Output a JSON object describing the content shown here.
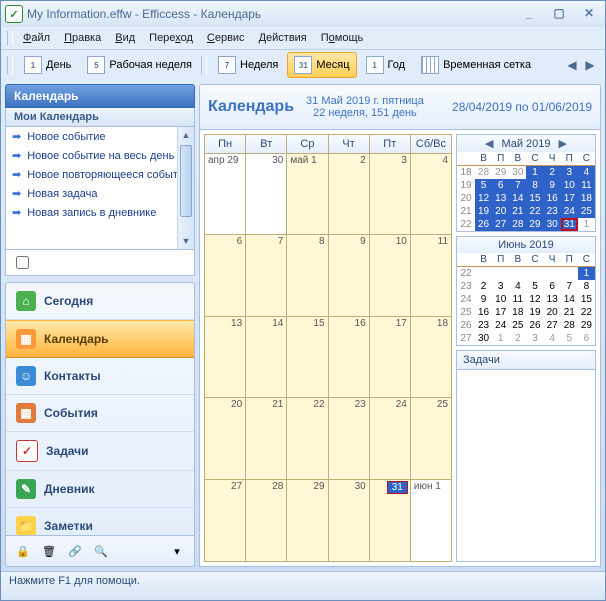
{
  "window": {
    "title": "My Information.effw - Efficcess - Календарь"
  },
  "menu": {
    "file": "Файл",
    "edit": "Правка",
    "view": "Вид",
    "goto": "Переход",
    "service": "Сервис",
    "actions": "Действия",
    "help": "Помощь"
  },
  "toolbar": {
    "day_ico": "1",
    "day": "День",
    "work_ico": "5",
    "workweek": "Рабочая неделя",
    "week_ico": "7",
    "week": "Неделя",
    "month_ico": "31",
    "month": "Месяц",
    "year_ico": "1",
    "year": "Год",
    "timegrid": "Временная сетка"
  },
  "sidebar": {
    "header": "Календарь",
    "subheader": "Мои Календарь",
    "links": {
      "new_event": "Новое событие",
      "new_allday": "Новое событие на весь день",
      "new_recurring": "Новое повторяющееся событие",
      "new_task": "Новая задача",
      "new_diary": "Новая запись в дневнике"
    },
    "nav": {
      "today": "Сегодня",
      "calendar": "Календарь",
      "contacts": "Контакты",
      "events": "События",
      "tasks": "Задачи",
      "diary": "Дневник",
      "notes": "Заметки"
    }
  },
  "calendar": {
    "title": "Календарь",
    "date_line": "31 Май 2019 г. пятница",
    "sub_line": "22 неделя, 151 день",
    "range": "28/04/2019 по 01/06/2019",
    "dow": [
      "Пн",
      "Вт",
      "Ср",
      "Чт",
      "Пт",
      "Сб/Вс"
    ],
    "grid": [
      [
        {
          "ml": "апр",
          "dn": "29",
          "out": true
        },
        {
          "dn": "30",
          "out": true
        },
        {
          "ml": "май",
          "dn": "1"
        },
        {
          "dn": "2"
        },
        {
          "dn": "3"
        },
        {
          "dn": "4",
          "wknd": true
        }
      ],
      [
        {
          "dn": "6"
        },
        {
          "dn": "7"
        },
        {
          "dn": "8"
        },
        {
          "dn": "9"
        },
        {
          "dn": "10"
        },
        {
          "dn": "11",
          "wknd": true
        }
      ],
      [
        {
          "dn": "13"
        },
        {
          "dn": "14"
        },
        {
          "dn": "15"
        },
        {
          "dn": "16"
        },
        {
          "dn": "17"
        },
        {
          "dn": "18",
          "wknd": true
        }
      ],
      [
        {
          "dn": "20"
        },
        {
          "dn": "21"
        },
        {
          "dn": "22"
        },
        {
          "dn": "23"
        },
        {
          "dn": "24"
        },
        {
          "dn": "25",
          "wknd": true
        }
      ],
      [
        {
          "dn": "27"
        },
        {
          "dn": "28"
        },
        {
          "dn": "29"
        },
        {
          "dn": "30"
        },
        {
          "dn": "31",
          "today": true
        },
        {
          "ml": "июн",
          "dn": "1",
          "out": true,
          "wknd": true
        }
      ]
    ]
  },
  "mini": {
    "may": {
      "title": "Май 2019",
      "dow": [
        "В",
        "П",
        "В",
        "С",
        "Ч",
        "П",
        "С"
      ],
      "weeks": [
        "18",
        "19",
        "20",
        "21",
        "22"
      ],
      "rows": [
        [
          {
            "t": "28",
            "o": 1
          },
          {
            "t": "29",
            "o": 1
          },
          {
            "t": "30",
            "o": 1
          },
          {
            "t": "1",
            "i": 1
          },
          {
            "t": "2",
            "i": 1
          },
          {
            "t": "3",
            "i": 1
          },
          {
            "t": "4",
            "i": 1
          }
        ],
        [
          {
            "t": "5",
            "i": 1
          },
          {
            "t": "6",
            "i": 1
          },
          {
            "t": "7",
            "i": 1
          },
          {
            "t": "8",
            "i": 1
          },
          {
            "t": "9",
            "i": 1
          },
          {
            "t": "10",
            "i": 1
          },
          {
            "t": "11",
            "i": 1
          }
        ],
        [
          {
            "t": "12",
            "i": 1
          },
          {
            "t": "13",
            "i": 1
          },
          {
            "t": "14",
            "i": 1
          },
          {
            "t": "15",
            "i": 1
          },
          {
            "t": "16",
            "i": 1
          },
          {
            "t": "17",
            "i": 1
          },
          {
            "t": "18",
            "i": 1
          }
        ],
        [
          {
            "t": "19",
            "i": 1
          },
          {
            "t": "20",
            "i": 1
          },
          {
            "t": "21",
            "i": 1
          },
          {
            "t": "22",
            "i": 1
          },
          {
            "t": "23",
            "i": 1
          },
          {
            "t": "24",
            "i": 1
          },
          {
            "t": "25",
            "i": 1
          }
        ],
        [
          {
            "t": "26",
            "i": 1
          },
          {
            "t": "27",
            "i": 1
          },
          {
            "t": "28",
            "i": 1
          },
          {
            "t": "29",
            "i": 1
          },
          {
            "t": "30",
            "i": 1
          },
          {
            "t": "31",
            "td": 1
          },
          {
            "t": "1",
            "o": 1
          }
        ]
      ]
    },
    "june": {
      "title": "Июнь 2019",
      "dow": [
        "В",
        "П",
        "В",
        "С",
        "Ч",
        "П",
        "С"
      ],
      "weeks": [
        "22",
        "23",
        "24",
        "25",
        "26",
        "27"
      ],
      "rows": [
        [
          {
            "t": ""
          },
          {
            "t": ""
          },
          {
            "t": ""
          },
          {
            "t": ""
          },
          {
            "t": ""
          },
          {
            "t": ""
          },
          {
            "t": "1",
            "j1": 1
          }
        ],
        [
          {
            "t": "2"
          },
          {
            "t": "3"
          },
          {
            "t": "4"
          },
          {
            "t": "5"
          },
          {
            "t": "6"
          },
          {
            "t": "7"
          },
          {
            "t": "8"
          }
        ],
        [
          {
            "t": "9"
          },
          {
            "t": "10"
          },
          {
            "t": "11"
          },
          {
            "t": "12"
          },
          {
            "t": "13"
          },
          {
            "t": "14"
          },
          {
            "t": "15"
          }
        ],
        [
          {
            "t": "16"
          },
          {
            "t": "17"
          },
          {
            "t": "18"
          },
          {
            "t": "19"
          },
          {
            "t": "20"
          },
          {
            "t": "21"
          },
          {
            "t": "22"
          }
        ],
        [
          {
            "t": "23"
          },
          {
            "t": "24"
          },
          {
            "t": "25"
          },
          {
            "t": "26"
          },
          {
            "t": "27"
          },
          {
            "t": "28"
          },
          {
            "t": "29"
          }
        ],
        [
          {
            "t": "30"
          },
          {
            "t": "1",
            "o": 1
          },
          {
            "t": "2",
            "o": 1
          },
          {
            "t": "3",
            "o": 1
          },
          {
            "t": "4",
            "o": 1
          },
          {
            "t": "5",
            "o": 1
          },
          {
            "t": "6",
            "o": 1
          }
        ]
      ]
    }
  },
  "tasks": {
    "header": "Задачи"
  },
  "status": {
    "text": "Нажмите F1 для помощи."
  }
}
